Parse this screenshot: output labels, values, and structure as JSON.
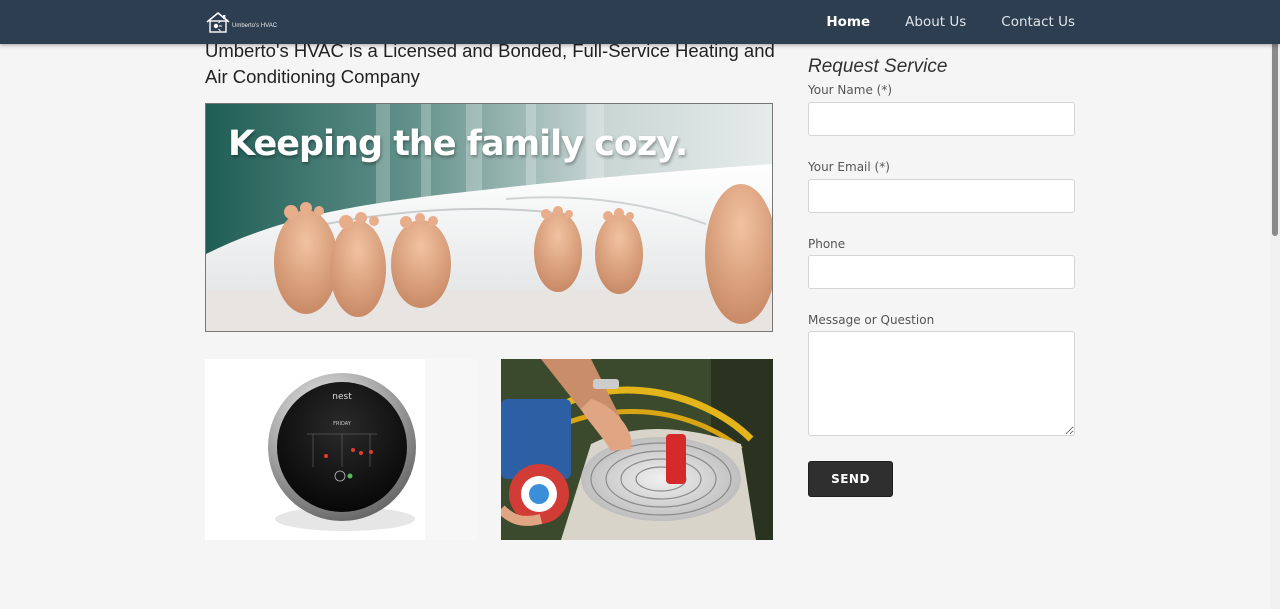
{
  "nav": {
    "brand_text": "Umberto's HVAC",
    "brand_icon": "house-logo-icon",
    "links": [
      {
        "label": "Home",
        "active": true
      },
      {
        "label": "About Us",
        "active": false
      },
      {
        "label": "Contact Us",
        "active": false
      }
    ]
  },
  "main": {
    "heading": "Umberto's HVAC is a Licensed and Bonded, Full-Service Heating and Air Conditioning Company",
    "hero_caption": "Keeping the family cozy.",
    "images": [
      {
        "name": "thermostat-image",
        "brand_mark": "nest",
        "day_text": "FRIDAY"
      },
      {
        "name": "ac-technician-image"
      }
    ]
  },
  "form": {
    "title": "Request Service",
    "fields": [
      {
        "label": "Your Name (*)",
        "value": ""
      },
      {
        "label": "Your Email (*)",
        "value": ""
      },
      {
        "label": "Phone",
        "value": ""
      },
      {
        "label": "Message or Question",
        "value": ""
      }
    ],
    "submit_label": "SEND"
  },
  "colors": {
    "navbar": "#2c3e50",
    "page_bg": "#f5f5f5",
    "button_bg": "#2f2f2f"
  }
}
